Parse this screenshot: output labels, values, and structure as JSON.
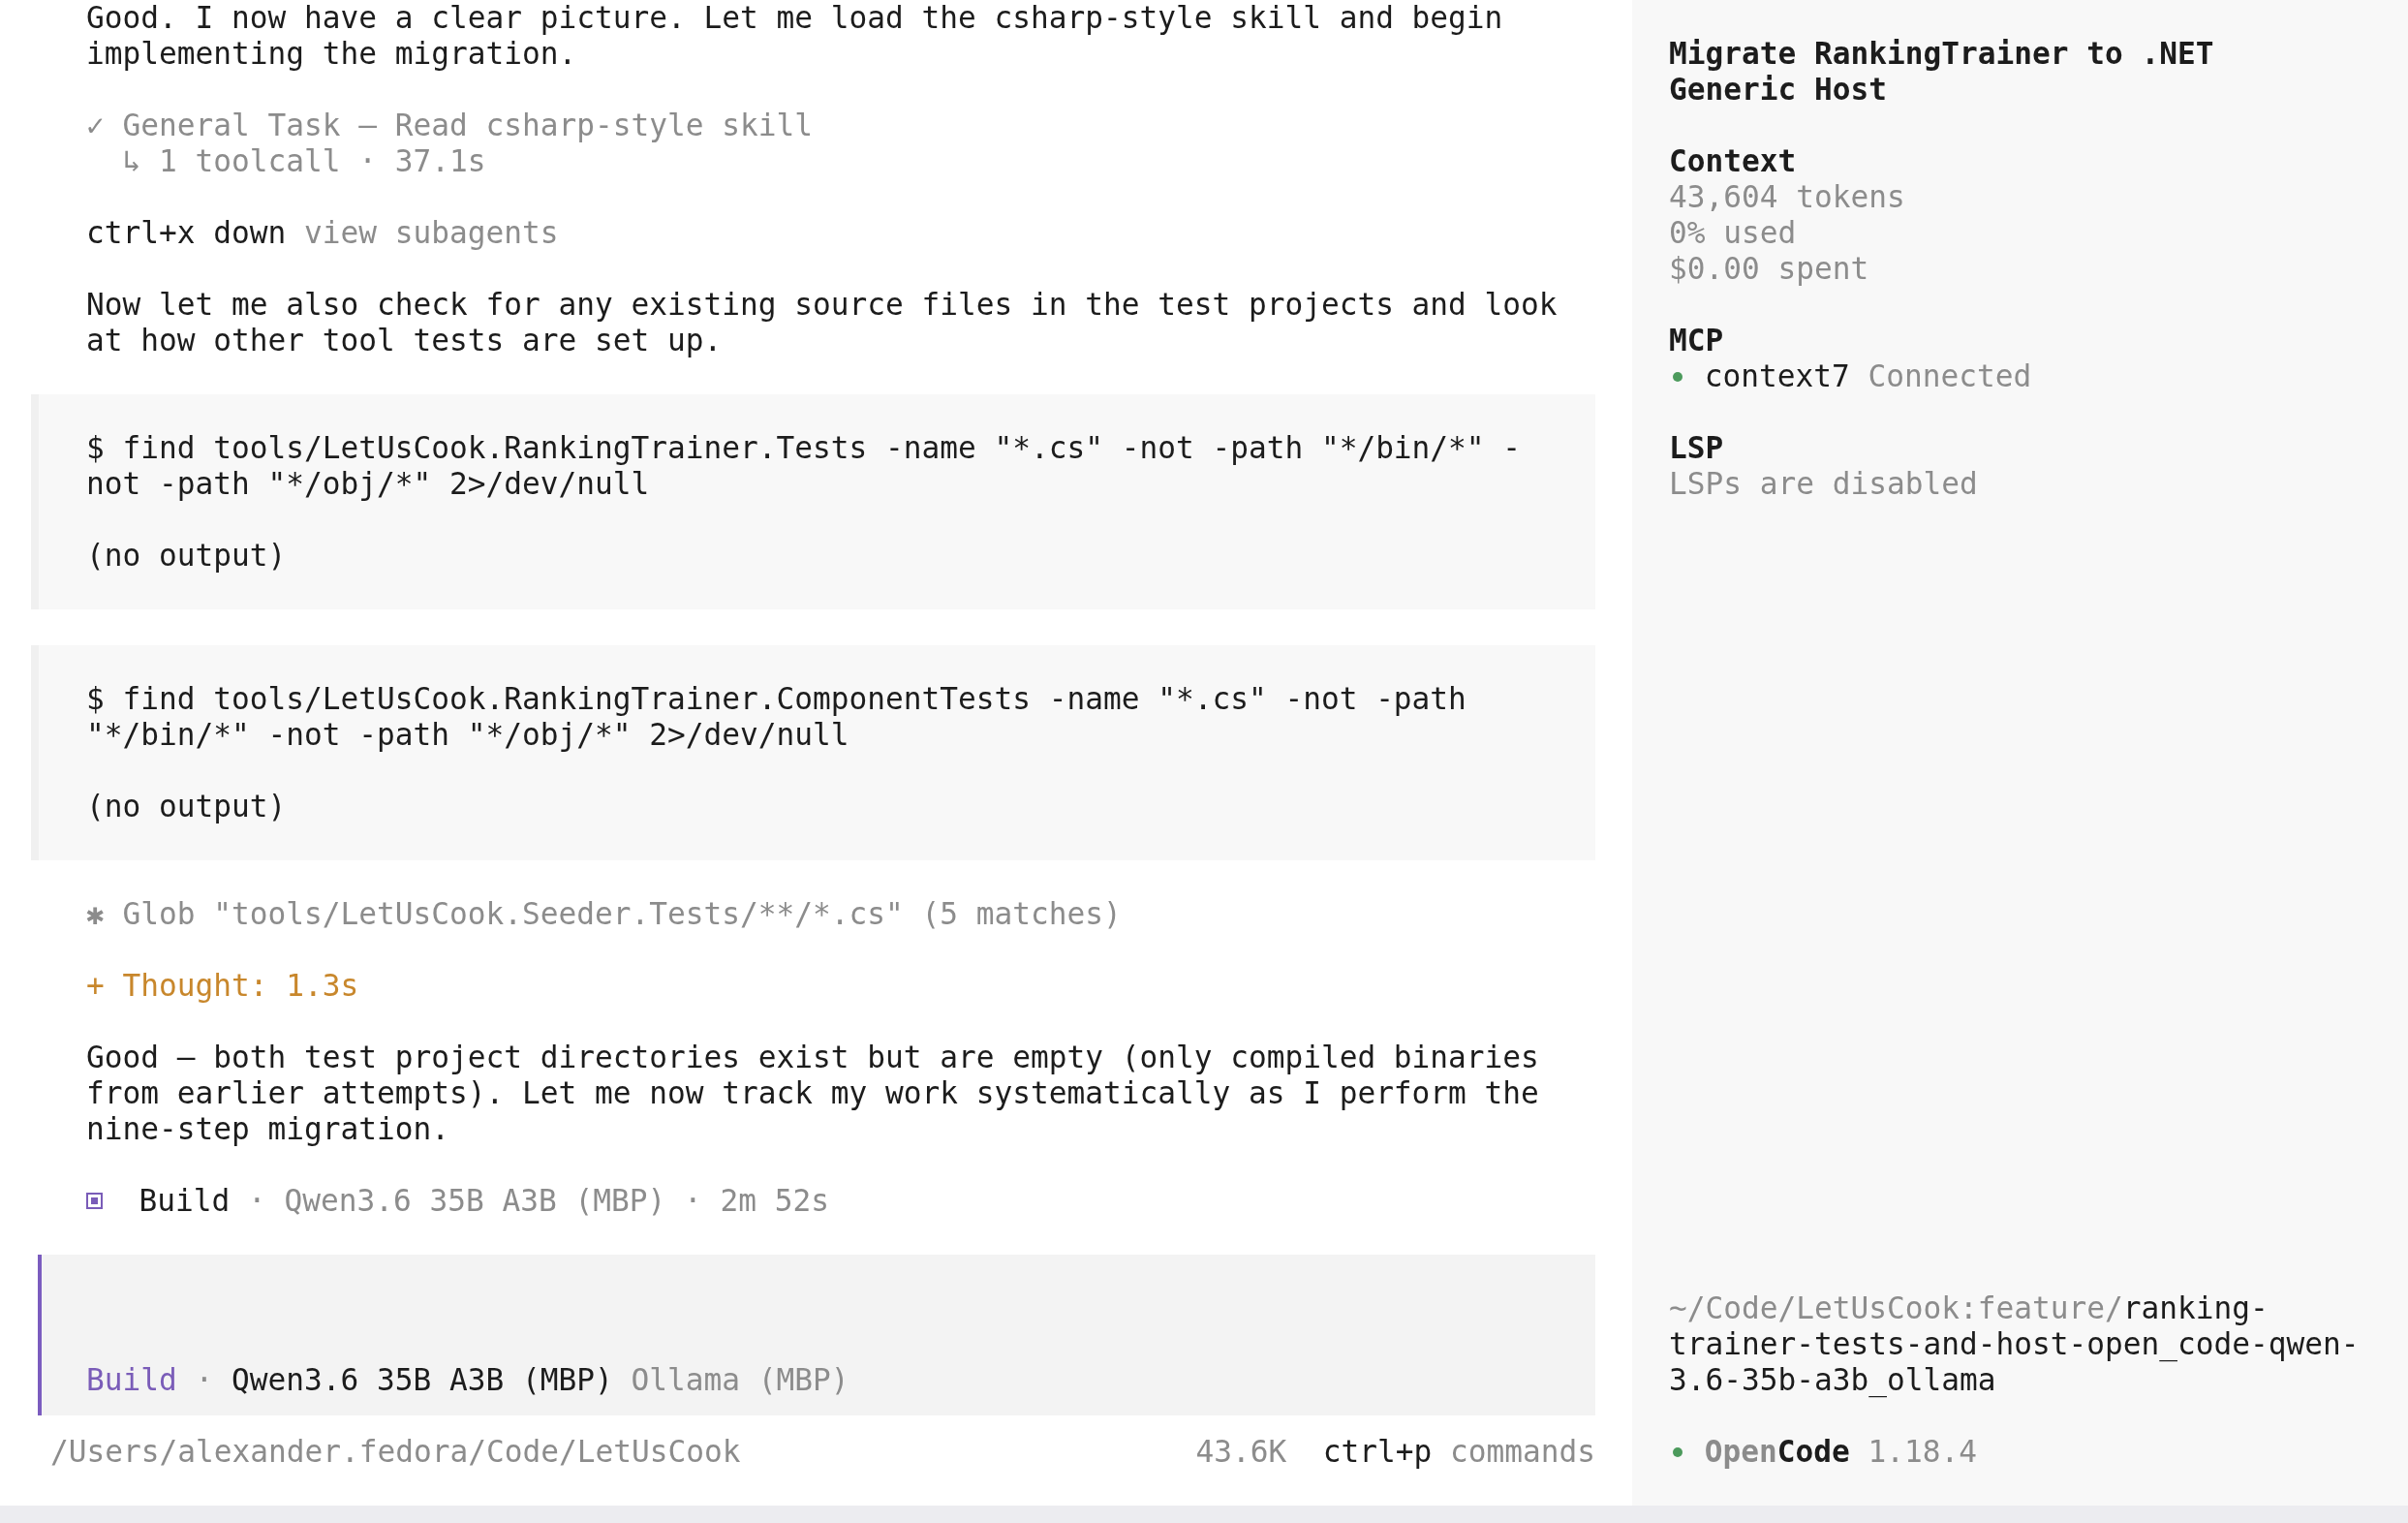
{
  "transcript": [
    {
      "kind": "text",
      "text": "Good. I now have a clear picture. Let me load the csharp-style skill and begin implementing the migration."
    },
    {
      "kind": "task",
      "title": "✓ General Task — Read csharp-style skill",
      "detail": "↳ 1 toolcall · 37.1s"
    },
    {
      "kind": "hint",
      "key": "ctrl+x down",
      "label": "view subagents"
    },
    {
      "kind": "text",
      "text": "Now let me also check for any existing source files in the test projects and look at how other tool tests are set up."
    },
    {
      "kind": "command",
      "command": "$ find tools/LetUsCook.RankingTrainer.Tests -name \"*.cs\" -not -path \"*/bin/*\" -not -path \"*/obj/*\" 2>/dev/null",
      "output": "(no output)"
    },
    {
      "kind": "command",
      "command": "$ find tools/LetUsCook.RankingTrainer.ComponentTests -name \"*.cs\" -not -path \"*/bin/*\" -not -path \"*/obj/*\" 2>/dev/null",
      "output": "(no output)"
    },
    {
      "kind": "tool",
      "text": "✱ Glob \"tools/LetUsCook.Seeder.Tests/**/*.cs\" (5 matches)"
    },
    {
      "kind": "thought",
      "text": "+ Thought: 1.3s"
    },
    {
      "kind": "text",
      "text": "Good — both test project directories exist but are empty (only compiled binaries from earlier attempts). Let me now track my work systematically as I perform the nine-step migration."
    },
    {
      "kind": "status",
      "agent": "Build",
      "details": "· Qwen3.6 35B A3B (MBP) · 2m 52s"
    }
  ],
  "prompt": {
    "agent": "Build",
    "separator": "·",
    "model": "Qwen3.6 35B A3B (MBP)",
    "provider": "Ollama (MBP)"
  },
  "status_bar": {
    "path": "/Users/alexander.fedora/Code/LetUsCook",
    "tokens": "43.6K",
    "shortcut_key": "ctrl+p",
    "shortcut_label": "commands"
  },
  "sidebar": {
    "title": "Migrate RankingTrainer to .NET Generic Host",
    "context": {
      "heading": "Context",
      "lines": [
        "43,604 tokens",
        "0% used",
        "$0.00 spent"
      ]
    },
    "mcp": {
      "heading": "MCP",
      "servers": [
        {
          "name": "context7",
          "status": "Connected",
          "color": "#4c9a5c"
        }
      ]
    },
    "lsp": {
      "heading": "LSP",
      "lines": [
        "LSPs are disabled"
      ]
    },
    "branch": {
      "path": "~/Code/LetUsCook:feature/",
      "name": "ranking-trainer-tests-and-host-open_code-qwen-3.6-35b-a3b_ollama"
    },
    "app": {
      "name_muted": "Open",
      "name_strong": "Code",
      "version": "1.18.4"
    }
  }
}
